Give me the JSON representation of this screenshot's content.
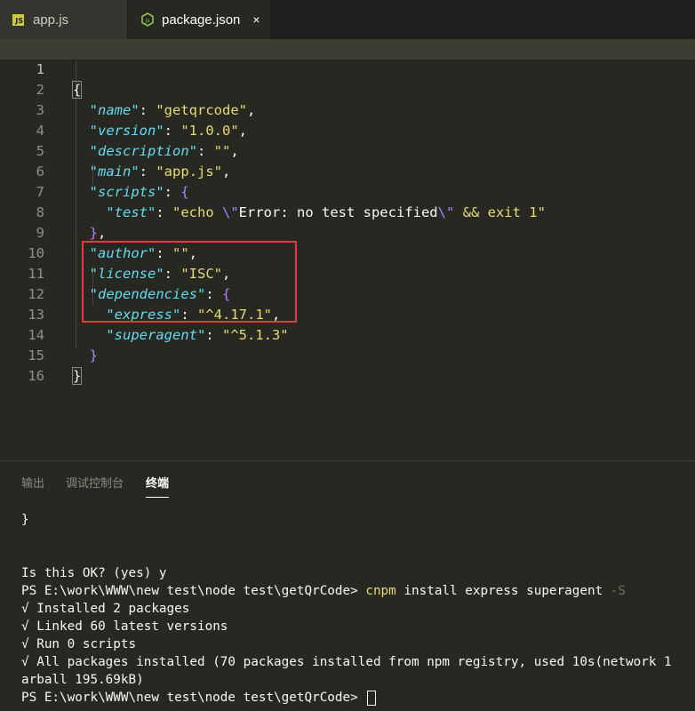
{
  "tabs": [
    {
      "label": "app.js",
      "icon": "js-file-icon",
      "active": false
    },
    {
      "label": "package.json",
      "icon": "node-json-icon",
      "active": true,
      "close": "×"
    }
  ],
  "editor": {
    "line_numbers": [
      "1",
      "2",
      "3",
      "4",
      "5",
      "6",
      "7",
      "8",
      "9",
      "10",
      "11",
      "12",
      "13",
      "14",
      "15",
      "16"
    ],
    "json": {
      "name_key": "\"name\"",
      "name_val": "\"getqrcode\"",
      "version_key": "\"version\"",
      "version_val": "\"1.0.0\"",
      "description_key": "\"description\"",
      "description_val": "\"\"",
      "main_key": "\"main\"",
      "main_val": "\"app.js\"",
      "scripts_key": "\"scripts\"",
      "test_key": "\"test\"",
      "test_val_1": "\"echo ",
      "test_val_2": "\\\"",
      "test_val_3": "Error: no test specified",
      "test_val_4": "\\\"",
      "test_val_5": " && exit 1\"",
      "author_key": "\"author\"",
      "author_val": "\"\"",
      "license_key": "\"license\"",
      "license_val": "\"ISC\"",
      "dependencies_key": "\"dependencies\"",
      "express_key": "\"express\"",
      "express_val": "\"^4.17.1\"",
      "superagent_key": "\"superagent\"",
      "superagent_val": "\"^5.1.3\""
    }
  },
  "panel": {
    "tabs": [
      "输出",
      "调试控制台",
      "终端"
    ],
    "active_tab": "终端",
    "terminal": {
      "line1": "}",
      "line2": "",
      "line3": "Is this OK? (yes) y",
      "prompt": "PS E:\\work\\WWW\\new test\\node test\\getQrCode> ",
      "cmd": "cnpm",
      "cmd_args": " install express superagent ",
      "cmd_flag": "-S",
      "check": "√",
      "ok1": " Installed 2 packages",
      "ok2": " Linked 60 latest versions",
      "ok3": " Run 0 scripts",
      "ok4": " All packages installed (70 packages installed from npm registry, used 10s(network 1",
      "ok4_cont": "arball 195.69kB)",
      "prompt2": "PS E:\\work\\WWW\\new test\\node test\\getQrCode> "
    }
  },
  "colors": {
    "background": "#272822",
    "keyword": "#66d9ef",
    "string": "#e6db74",
    "bracket": "#ae81ff",
    "highlight_box": "#e6393b"
  }
}
